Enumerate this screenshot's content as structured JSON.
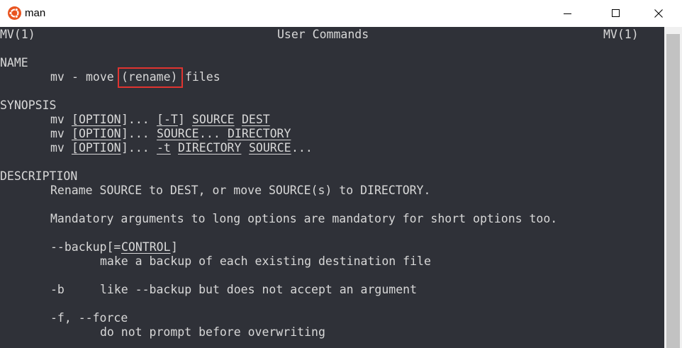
{
  "window": {
    "title": "man",
    "icon": "ubuntu-logo-icon",
    "controls": {
      "minimize": "minimize-icon",
      "maximize": "maximize-icon",
      "close": "close-icon"
    },
    "colors": {
      "terminal_bg": "#2f3138",
      "text": "#d8d8d8",
      "highlight": "#e03430",
      "ubuntu_orange": "#e95420"
    }
  },
  "man": {
    "header": {
      "left": "MV(1)",
      "center": "User Commands",
      "right": "MV(1)"
    },
    "name": {
      "heading": "NAME",
      "cmd": "mv",
      "dash": "-",
      "text_before": "move",
      "highlighted": "(rename)",
      "text_after": "files"
    },
    "synopsis": {
      "heading": "SYNOPSIS",
      "lines": [
        {
          "cmd": "mv",
          "a1": "[",
          "a2": "OPTION",
          "a3": "]...",
          "b1": "[",
          "b2": "-T",
          "b3": "]",
          "c": "SOURCE",
          "d": "DEST"
        },
        {
          "cmd": "mv",
          "a1": "[",
          "a2": "OPTION",
          "a3": "]...",
          "c": "SOURCE",
          "c2": "...",
          "d": "DIRECTORY"
        },
        {
          "cmd": "mv",
          "a1": "[",
          "a2": "OPTION",
          "a3": "]...",
          "b2": "-t",
          "c": "DIRECTORY",
          "d": "SOURCE",
          "d2": "..."
        }
      ]
    },
    "description": {
      "heading": "DESCRIPTION",
      "line1": "Rename SOURCE to DEST, or move SOURCE(s) to DIRECTORY.",
      "line2": "Mandatory arguments to long options are mandatory for short options too.",
      "opt_backup": {
        "flag": "--backup[=",
        "arg": "CONTROL",
        "close": "]",
        "desc": "make a backup of each existing destination file"
      },
      "opt_b": {
        "flag": "-b",
        "desc": "like --backup but does not accept an argument"
      },
      "opt_f": {
        "flag": "-f, --force",
        "desc": "do not prompt before overwriting"
      }
    }
  }
}
